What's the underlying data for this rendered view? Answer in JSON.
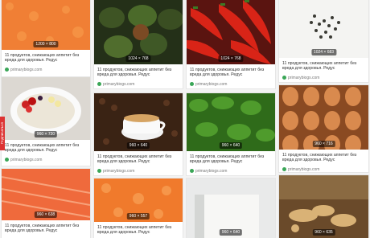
{
  "feed": {
    "caption": "11 продуктов, снижающих аппетит без вреда для здоровья. Редус",
    "source": "primarybiogs.com",
    "side_tab": "Подписаться"
  },
  "cards": [
    {
      "badge": "1200 × 800"
    },
    {
      "badge": "1024 × 768"
    },
    {
      "badge": "1024 × 768"
    },
    {
      "badge": "1024 × 683"
    },
    {
      "badge": "960 × 720"
    },
    {
      "badge": "960 × 640"
    },
    {
      "badge": "960 × 640"
    },
    {
      "badge": "960 × 716"
    },
    {
      "badge": "960 × 638"
    },
    {
      "badge": "960 × 557"
    },
    {
      "badge": "960 × 640"
    },
    {
      "badge": "960 × 635"
    }
  ],
  "colors": {
    "source_dot": "#3aa657",
    "side_tab": "#dd3333"
  }
}
